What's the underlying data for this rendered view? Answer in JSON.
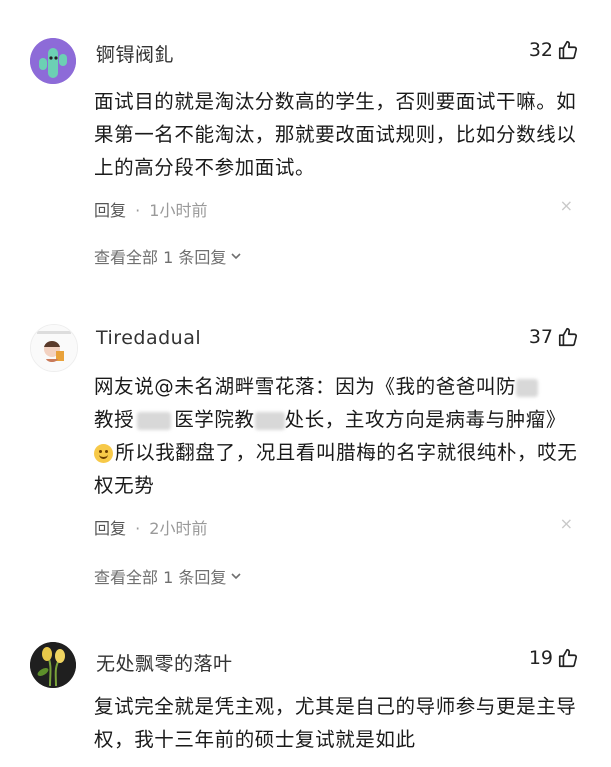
{
  "comments": [
    {
      "username": "锕锝阀釓",
      "likes": "32",
      "text": "面试目的就是淘汰分数高的学生，否则要面试干嘛。如果第一名不能淘汰，那就要改面试规则，比如分数线以上的高分段不参加面试。",
      "reply_label": "回复",
      "separator": "·",
      "time": "1小时前",
      "close": "×",
      "view_all": "查看全部 1 条回复",
      "avatar_icon": "cactus-avatar-icon",
      "accent": "#5bb8a8"
    },
    {
      "username": "Tiredadual",
      "likes": "37",
      "text_parts": {
        "p1": "网友说@未名湖畔雪花落：因为《我的爸爸叫防",
        "p2": "教授",
        "p3": "医学院教",
        "p4": "处长，主攻方向是病毒与肿瘤》",
        "p5": "所以我翻盘了，况且看叫腊梅的名字就很纯朴，哎无权无势"
      },
      "reply_label": "回复",
      "separator": "·",
      "time": "2小时前",
      "close": "×",
      "view_all": "查看全部 1 条回复",
      "avatar_icon": "cartoon-avatar-icon"
    },
    {
      "username": "无处飘零的落叶",
      "likes": "19",
      "text": "复试完全就是凭主观，尤其是自己的导师参与更是主导权，我十三年前的硕士复试就是如此",
      "avatar_icon": "flower-avatar-icon"
    }
  ]
}
